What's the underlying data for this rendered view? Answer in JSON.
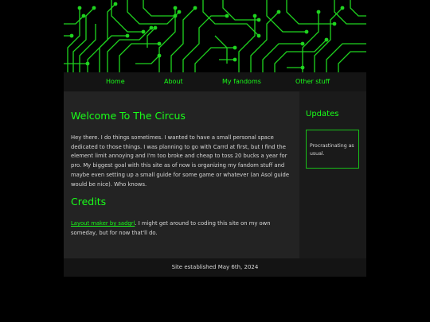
{
  "nav": {
    "home": "Home",
    "about": "About",
    "fandoms": "My fandoms",
    "other": "Other stuff"
  },
  "main": {
    "title": "Welcome To The Circus",
    "intro": "Hey there. I do things sometimes. I wanted to have a small personal space dedicated to those things. I was planning to go with Carrd at first, but I find the element limit annoying and I'm too broke and cheap to toss 20 bucks a year for pro. My biggest goal with this site as of now is organizing my fandom stuff and maybe even setting up a small guide for some game or whatever (an Asol guide would be nice). Who knows.",
    "credits_title": "Credits",
    "credits_link": "Layout maker by sadgrl",
    "credits_text": ". I might get around to coding this site on my own someday, but for now that'll do."
  },
  "sidebar": {
    "title": "Updates",
    "update": "Procrastinating as usual."
  },
  "footer": {
    "text": "Site established May 6th, 2024"
  },
  "colors": {
    "accent": "#19ff19",
    "background": "#000000",
    "content_bg": "#232323"
  }
}
